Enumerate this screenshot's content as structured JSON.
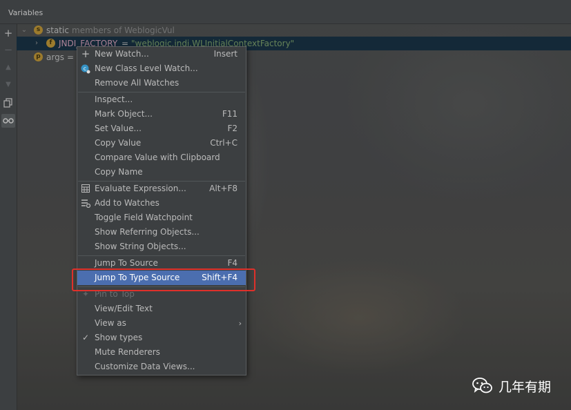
{
  "panel": {
    "title": "Variables"
  },
  "tree": {
    "static_row": {
      "badge": "s",
      "label": "static",
      "suffix": "members of WeblogicVul"
    },
    "field_row": {
      "badge": "f",
      "name": "JNDI_FACTORY",
      "eq": "=",
      "value": "\"weblogic.jndi.WLInitialContextFactory\""
    },
    "args_row": {
      "badge": "p",
      "name": "args",
      "eq": "="
    }
  },
  "menu": {
    "items": [
      {
        "label": "New Watch...",
        "shortcut": "Insert",
        "icon": "plus-icon"
      },
      {
        "label": "New Class Level Watch...",
        "shortcut": "",
        "icon": "class-watch-icon"
      },
      {
        "label": "Remove All Watches",
        "shortcut": ""
      },
      {
        "label": "Inspect...",
        "shortcut": ""
      },
      {
        "label": "Mark Object...",
        "shortcut": "F11"
      },
      {
        "label": "Set Value...",
        "shortcut": "F2"
      },
      {
        "label": "Copy Value",
        "shortcut": "Ctrl+C"
      },
      {
        "label": "Compare Value with Clipboard",
        "shortcut": ""
      },
      {
        "label": "Copy Name",
        "shortcut": ""
      },
      {
        "label": "Evaluate Expression...",
        "shortcut": "Alt+F8",
        "icon": "calculator-icon"
      },
      {
        "label": "Add to Watches",
        "shortcut": "",
        "icon": "watches-icon"
      },
      {
        "label": "Toggle Field Watchpoint",
        "shortcut": ""
      },
      {
        "label": "Show Referring Objects...",
        "shortcut": ""
      },
      {
        "label": "Show String Objects...",
        "shortcut": ""
      },
      {
        "label": "Jump To Source",
        "shortcut": "F4"
      },
      {
        "label": "Jump To Type Source",
        "shortcut": "Shift+F4",
        "highlighted": true
      },
      {
        "label": "Pin to Top",
        "shortcut": "",
        "disabled": true,
        "icon": "pin-icon"
      },
      {
        "label": "View/Edit Text",
        "shortcut": ""
      },
      {
        "label": "View as",
        "shortcut": "",
        "submenu": true
      },
      {
        "label": "Show types",
        "shortcut": "",
        "checked": true
      },
      {
        "label": "Mute Renderers",
        "shortcut": ""
      },
      {
        "label": "Customize Data Views...",
        "shortcut": ""
      }
    ]
  },
  "watermark": {
    "text": "几年有期",
    "icon": "wechat-icon"
  },
  "colors": {
    "highlight": "#4b6eaf",
    "annotation": "#e0302a",
    "badge_static": "#c99a2e",
    "badge_field": "#c99a2e",
    "badge_param": "#c99a2e"
  }
}
